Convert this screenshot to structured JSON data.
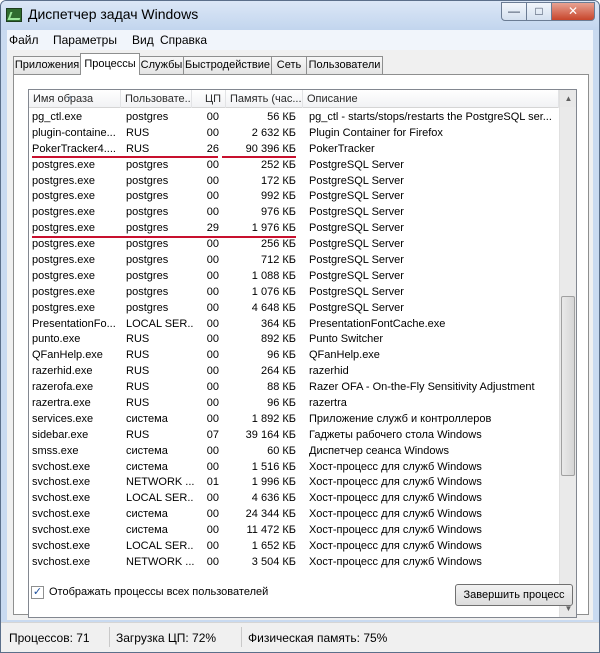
{
  "window": {
    "title": "Диспетчер задач Windows"
  },
  "menu": [
    "Файл",
    "Параметры",
    "Вид",
    "Справка"
  ],
  "tabs": [
    "Приложения",
    "Процессы",
    "Службы",
    "Быстродействие",
    "Сеть",
    "Пользователи"
  ],
  "active_tab": "Процессы",
  "columns": [
    "Имя образа",
    "Пользовате...",
    "ЦП",
    "Память (час...",
    "Описание"
  ],
  "rows": [
    {
      "name": "pg_ctl.exe",
      "user": "postgres",
      "cpu": "00",
      "mem": "56 КБ",
      "desc": "pg_ctl - starts/stops/restarts the PostgreSQL ser..."
    },
    {
      "name": "plugin-containe...",
      "user": "RUS",
      "cpu": "00",
      "mem": "2 632 КБ",
      "desc": "Plugin Container for Firefox"
    },
    {
      "name": "PokerTracker4....",
      "user": "RUS",
      "cpu": "26",
      "mem": "90 396 КБ",
      "desc": "PokerTracker"
    },
    {
      "name": "postgres.exe",
      "user": "postgres",
      "cpu": "00",
      "mem": "252 КБ",
      "desc": "PostgreSQL Server"
    },
    {
      "name": "postgres.exe",
      "user": "postgres",
      "cpu": "00",
      "mem": "172 КБ",
      "desc": "PostgreSQL Server"
    },
    {
      "name": "postgres.exe",
      "user": "postgres",
      "cpu": "00",
      "mem": "992 КБ",
      "desc": "PostgreSQL Server"
    },
    {
      "name": "postgres.exe",
      "user": "postgres",
      "cpu": "00",
      "mem": "976 КБ",
      "desc": "PostgreSQL Server"
    },
    {
      "name": "postgres.exe",
      "user": "postgres",
      "cpu": "29",
      "mem": "1 976 КБ",
      "desc": "PostgreSQL Server"
    },
    {
      "name": "postgres.exe",
      "user": "postgres",
      "cpu": "00",
      "mem": "256 КБ",
      "desc": "PostgreSQL Server"
    },
    {
      "name": "postgres.exe",
      "user": "postgres",
      "cpu": "00",
      "mem": "712 КБ",
      "desc": "PostgreSQL Server"
    },
    {
      "name": "postgres.exe",
      "user": "postgres",
      "cpu": "00",
      "mem": "1 088 КБ",
      "desc": "PostgreSQL Server"
    },
    {
      "name": "postgres.exe",
      "user": "postgres",
      "cpu": "00",
      "mem": "1 076 КБ",
      "desc": "PostgreSQL Server"
    },
    {
      "name": "postgres.exe",
      "user": "postgres",
      "cpu": "00",
      "mem": "4 648 КБ",
      "desc": "PostgreSQL Server"
    },
    {
      "name": "PresentationFo...",
      "user": "LOCAL SER...",
      "cpu": "00",
      "mem": "364 КБ",
      "desc": "PresentationFontCache.exe"
    },
    {
      "name": "punto.exe",
      "user": "RUS",
      "cpu": "00",
      "mem": "892 КБ",
      "desc": "Punto Switcher"
    },
    {
      "name": "QFanHelp.exe",
      "user": "RUS",
      "cpu": "00",
      "mem": "96 КБ",
      "desc": "QFanHelp.exe"
    },
    {
      "name": "razerhid.exe",
      "user": "RUS",
      "cpu": "00",
      "mem": "264 КБ",
      "desc": "razerhid"
    },
    {
      "name": "razerofa.exe",
      "user": "RUS",
      "cpu": "00",
      "mem": "88 КБ",
      "desc": "Razer OFA - On-the-Fly Sensitivity Adjustment"
    },
    {
      "name": "razertra.exe",
      "user": "RUS",
      "cpu": "00",
      "mem": "96 КБ",
      "desc": "razertra"
    },
    {
      "name": "services.exe",
      "user": "система",
      "cpu": "00",
      "mem": "1 892 КБ",
      "desc": "Приложение служб и контроллеров"
    },
    {
      "name": "sidebar.exe",
      "user": "RUS",
      "cpu": "07",
      "mem": "39 164 КБ",
      "desc": "Гаджеты рабочего стола Windows"
    },
    {
      "name": "smss.exe",
      "user": "система",
      "cpu": "00",
      "mem": "60 КБ",
      "desc": "Диспетчер сеанса  Windows"
    },
    {
      "name": "svchost.exe",
      "user": "система",
      "cpu": "00",
      "mem": "1 516 КБ",
      "desc": "Хост-процесс для служб Windows"
    },
    {
      "name": "svchost.exe",
      "user": "NETWORK ...",
      "cpu": "01",
      "mem": "1 996 КБ",
      "desc": "Хост-процесс для служб Windows"
    },
    {
      "name": "svchost.exe",
      "user": "LOCAL SER...",
      "cpu": "00",
      "mem": "4 636 КБ",
      "desc": "Хост-процесс для служб Windows"
    },
    {
      "name": "svchost.exe",
      "user": "система",
      "cpu": "00",
      "mem": "24 344 КБ",
      "desc": "Хост-процесс для служб Windows"
    },
    {
      "name": "svchost.exe",
      "user": "система",
      "cpu": "00",
      "mem": "11 472 КБ",
      "desc": "Хост-процесс для служб Windows"
    },
    {
      "name": "svchost.exe",
      "user": "LOCAL SER...",
      "cpu": "00",
      "mem": "1 652 КБ",
      "desc": "Хост-процесс для служб Windows"
    },
    {
      "name": "svchost.exe",
      "user": "NETWORK ...",
      "cpu": "00",
      "mem": "3 504 КБ",
      "desc": "Хост-процесс для служб Windows"
    }
  ],
  "show_all_label": "Отображать процессы всех пользователей",
  "show_all_checked": true,
  "end_process_label": "Завершить процесс",
  "status": {
    "processes": "Процессов: 71",
    "cpu": "Загрузка ЦП: 72%",
    "memory": "Физическая память: 75%"
  },
  "colors": {
    "highlight_line": "#c8102e"
  }
}
